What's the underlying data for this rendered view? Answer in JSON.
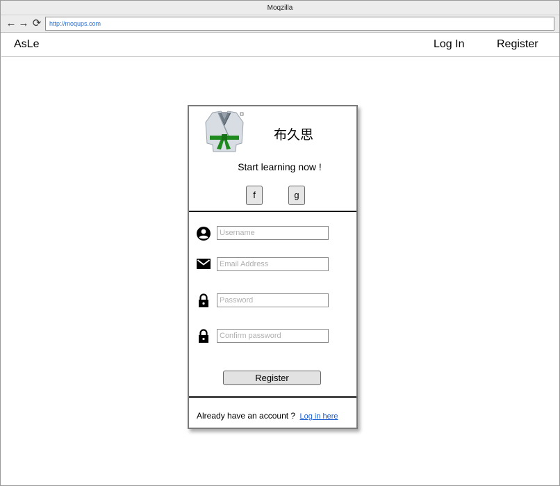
{
  "window": {
    "title": "Moqzilla",
    "url": "http://moqups.com"
  },
  "browser_nav": {
    "back_glyph": "←",
    "forward_glyph": "→",
    "reload_glyph": "⟳"
  },
  "site": {
    "brand": "AsLe",
    "nav": {
      "login": "Log In",
      "register": "Register"
    }
  },
  "card": {
    "logo_icon": "karate-gi-green-belt-icon",
    "kanji": "布久思",
    "tagline": "Start learning now !",
    "social": {
      "facebook": "f",
      "google": "g"
    },
    "fields": {
      "username": {
        "placeholder": "Username",
        "value": "",
        "icon": "user-circle-icon"
      },
      "email": {
        "placeholder": "Email Address",
        "value": "",
        "icon": "envelope-icon"
      },
      "password": {
        "placeholder": "Password",
        "value": "",
        "icon": "lock-icon"
      },
      "confirm": {
        "placeholder": "Confirm password",
        "value": "",
        "icon": "lock-icon"
      }
    },
    "register_button": "Register",
    "footer": {
      "text": "Already have an account ?",
      "link": "Log in here"
    }
  },
  "colors": {
    "belt": "#1e8a1e",
    "gi": "#d8dde3",
    "link": "#1a5fd1"
  }
}
